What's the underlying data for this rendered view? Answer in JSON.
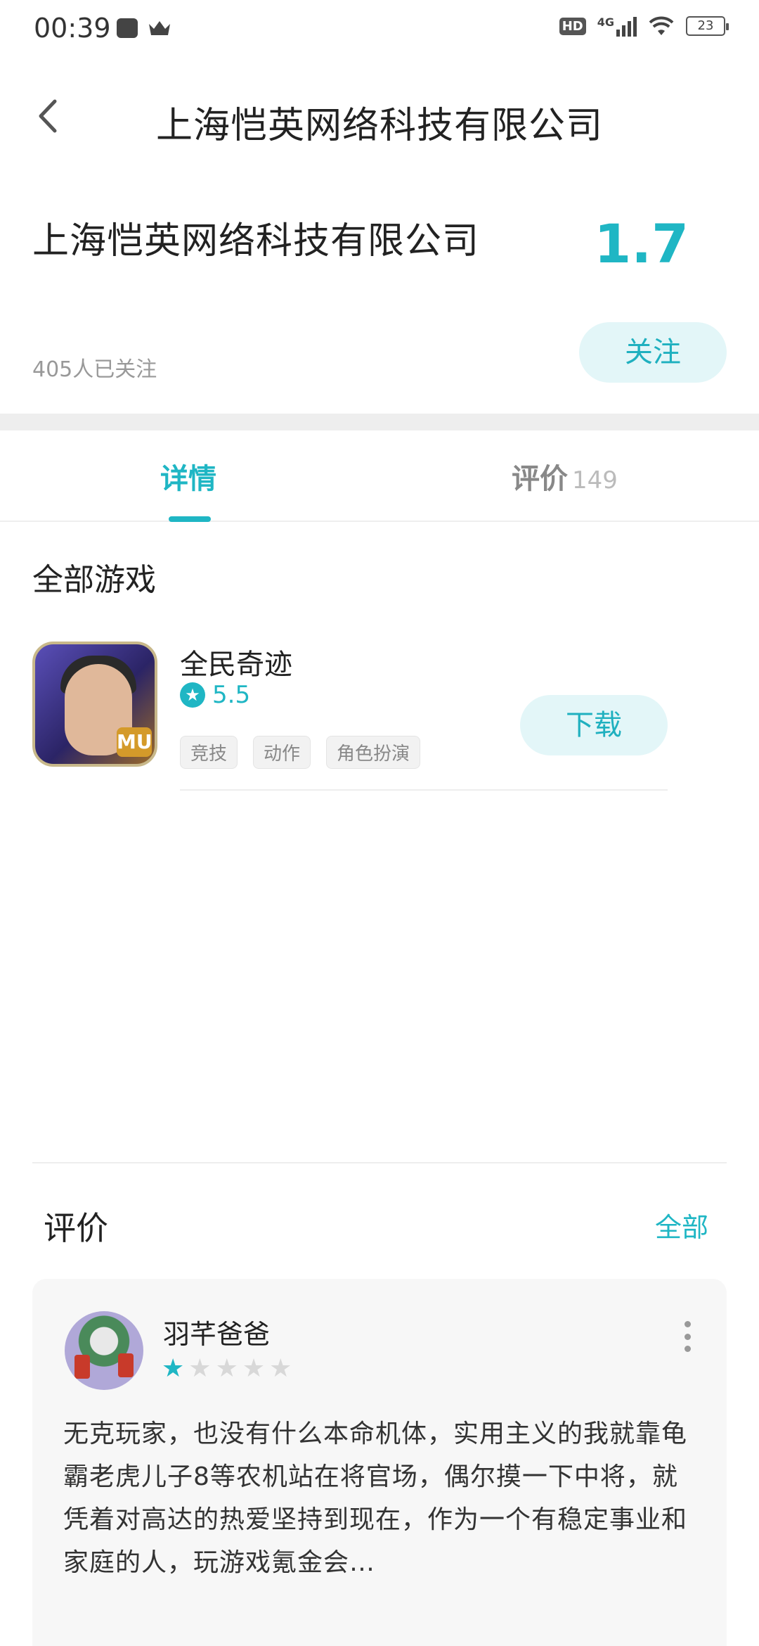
{
  "status_bar": {
    "time": "00:39",
    "hd": "HD",
    "network": "4G",
    "battery": "23"
  },
  "nav": {
    "title": "上海恺英网络科技有限公司"
  },
  "company": {
    "name": "上海恺英网络科技有限公司",
    "rating": "1.7",
    "followers": "405人已关注",
    "follow_label": "关注"
  },
  "tabs": {
    "detail": "详情",
    "review": "评价",
    "review_count": "149"
  },
  "games_section": {
    "title": "全部游戏",
    "games": [
      {
        "name": "全民奇迹",
        "score": "5.5",
        "tags": [
          "竞技",
          "动作",
          "角色扮演"
        ],
        "download_label": "下载"
      }
    ]
  },
  "reviews_section": {
    "title": "评价",
    "all_label": "全部",
    "reviews": [
      {
        "user": "羽芊爸爸",
        "stars": 1,
        "max_stars": 5,
        "text": "无克玩家，也没有什么本命机体，实用主义的我就靠龟霸老虎儿子8等农机站在将官场，偶尔摸一下中将，就凭着对高达的热爱坚持到现在，作为一个有稳定事业和家庭的人，玩游戏氪金会…"
      }
    ]
  },
  "colors": {
    "accent": "#1fb6c4",
    "button_bg": "#e3f6f8"
  }
}
